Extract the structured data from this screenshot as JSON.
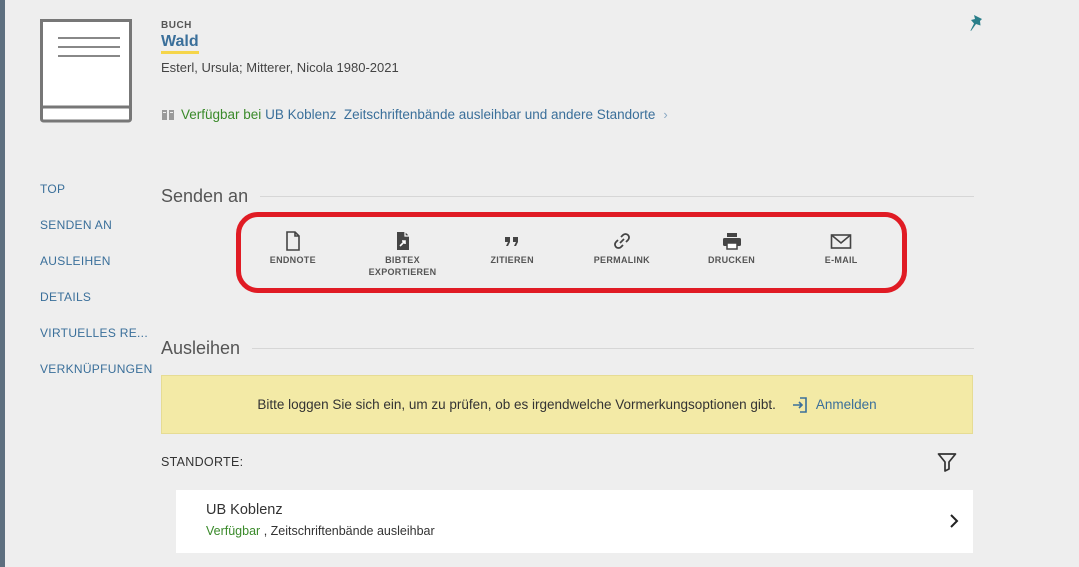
{
  "record": {
    "type_label": "BUCH",
    "title": "Wald",
    "authors": "Esterl, Ursula; Mitterer, Nicola 1980-2021",
    "availability": {
      "status": "Verfügbar bei",
      "library": "UB Koblenz",
      "detail": "Zeitschriftenbände ausleihbar und andere Standorte"
    }
  },
  "side_nav": {
    "items": [
      {
        "label": "TOP"
      },
      {
        "label": "SENDEN AN"
      },
      {
        "label": "AUSLEIHEN"
      },
      {
        "label": "DETAILS"
      },
      {
        "label": "VIRTUELLES RE..."
      },
      {
        "label": "VERKNÜPFUNGEN"
      }
    ]
  },
  "send_section": {
    "title": "Senden an",
    "actions": [
      {
        "label": "ENDNOTE",
        "icon": "file-icon"
      },
      {
        "label": "BIBTEX\nEXPORTIEREN",
        "icon": "file-export-icon"
      },
      {
        "label": "ZITIEREN",
        "icon": "quote-icon"
      },
      {
        "label": "PERMALINK",
        "icon": "link-icon"
      },
      {
        "label": "DRUCKEN",
        "icon": "printer-icon"
      },
      {
        "label": "E-MAIL",
        "icon": "mail-icon"
      }
    ],
    "highlight_color": "#e01b24"
  },
  "borrow_section": {
    "title": "Ausleihen",
    "login_message": "Bitte loggen Sie sich ein, um zu prüfen, ob es irgendwelche Vormerkungsoptionen gibt.",
    "login_label": "Anmelden",
    "locations_label": "STANDORTE:",
    "locations": [
      {
        "name": "UB Koblenz",
        "status": "Verfügbar",
        "detail": ", Zeitschriftenbände ausleihbar"
      }
    ]
  },
  "colors": {
    "link": "#3a6f9a",
    "available": "#3a8a2a",
    "login_bg": "#f3eaa6",
    "title_underline": "#f5d54a"
  }
}
